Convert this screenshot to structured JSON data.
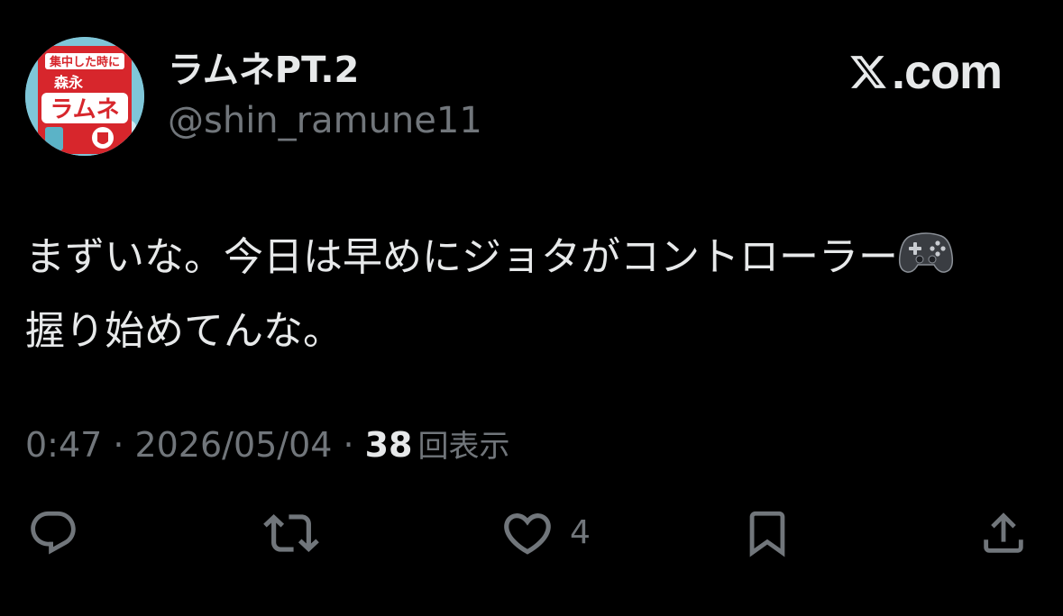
{
  "author": {
    "display_name": "ラムネPT.2",
    "handle": "@shin_ramune11",
    "avatar": {
      "description": "Morinaga Ramune candy bottle",
      "brand_text": "森永",
      "product_text": "ラムネ",
      "promo_text": "集中した時に"
    }
  },
  "brand": {
    "logo_icon": "x-logo-icon",
    "domain": ".com"
  },
  "tweet": {
    "text_line1": "まずいな。今日は早めにジョタがコントローラー",
    "emoji_icon": "game-controller-icon",
    "text_line2": "握り始めてんな。"
  },
  "meta": {
    "time": "0:47",
    "separator": "·",
    "date": "2026/05/04",
    "views_count": "38",
    "views_label": "回表示"
  },
  "actions": {
    "reply_icon": "reply-icon",
    "retweet_icon": "retweet-icon",
    "like_icon": "heart-icon",
    "like_count": "4",
    "bookmark_icon": "bookmark-icon",
    "share_icon": "share-icon"
  },
  "colors": {
    "background": "#000000",
    "primary_text": "#e7e9ea",
    "secondary_text": "#71767b",
    "avatar_red": "#d7262c",
    "avatar_teal": "#7fc6d8"
  }
}
